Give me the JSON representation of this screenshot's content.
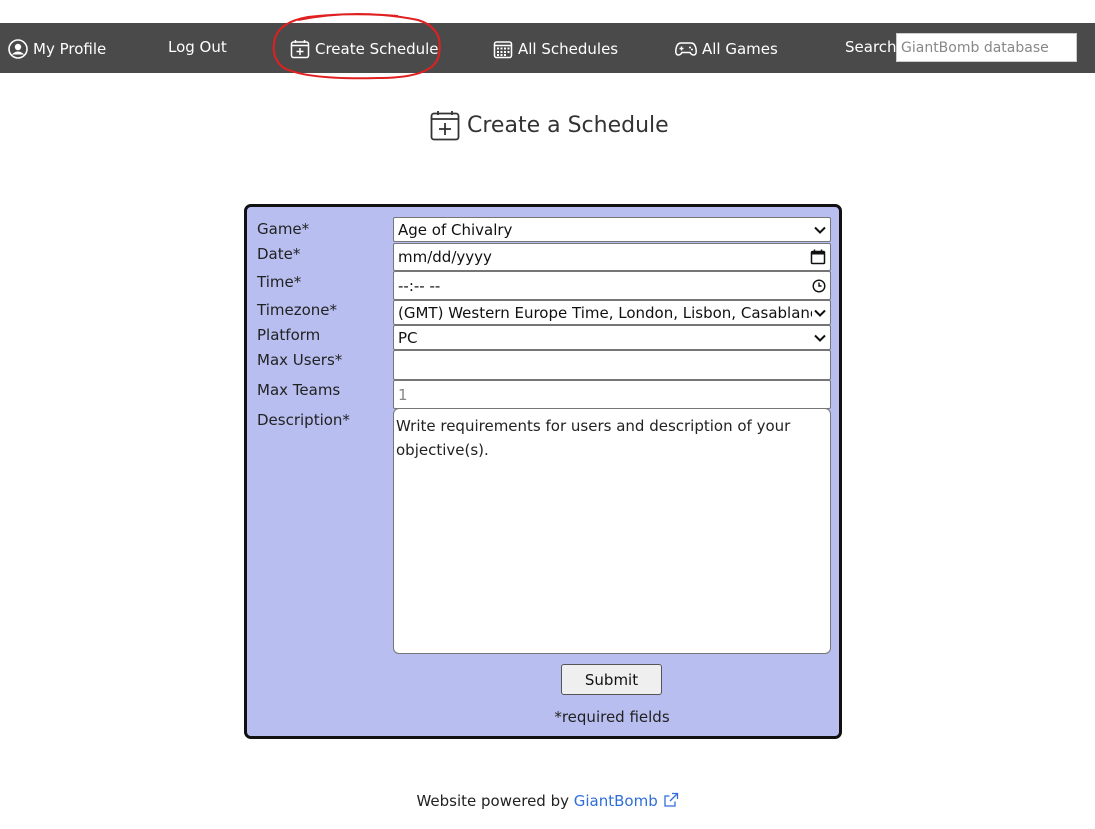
{
  "nav": {
    "profile_label": "My Profile",
    "logout_label": "Log Out",
    "create_schedule_label": "Create Schedule",
    "all_schedules_label": "All Schedules",
    "all_games_label": "All Games",
    "search_label": "Search",
    "search_placeholder": "GiantBomb database"
  },
  "page": {
    "title": "Create a Schedule"
  },
  "form": {
    "game": {
      "label": "Game*",
      "value": "Age of Chivalry"
    },
    "date": {
      "label": "Date*",
      "value": "mm/dd/yyyy"
    },
    "time": {
      "label": "Time*",
      "value": "--:-- --"
    },
    "timezone": {
      "label": "Timezone*",
      "value": "(GMT) Western Europe Time, London, Lisbon, Casablanca"
    },
    "platform": {
      "label": "Platform",
      "value": "PC"
    },
    "max_users": {
      "label": "Max Users*",
      "value": ""
    },
    "max_teams": {
      "label": "Max Teams",
      "placeholder": "1"
    },
    "description": {
      "label": "Description*",
      "placeholder": "Write requirements for users and description of your objective(s)."
    },
    "submit_label": "Submit",
    "required_note": "*required fields"
  },
  "footer": {
    "text": "Website powered by",
    "link_label": "GiantBomb"
  },
  "colors": {
    "navbar_bg": "#4a4a4a",
    "form_bg": "#b8bff0",
    "link": "#2f6ed8",
    "annotation": "#e02020"
  }
}
